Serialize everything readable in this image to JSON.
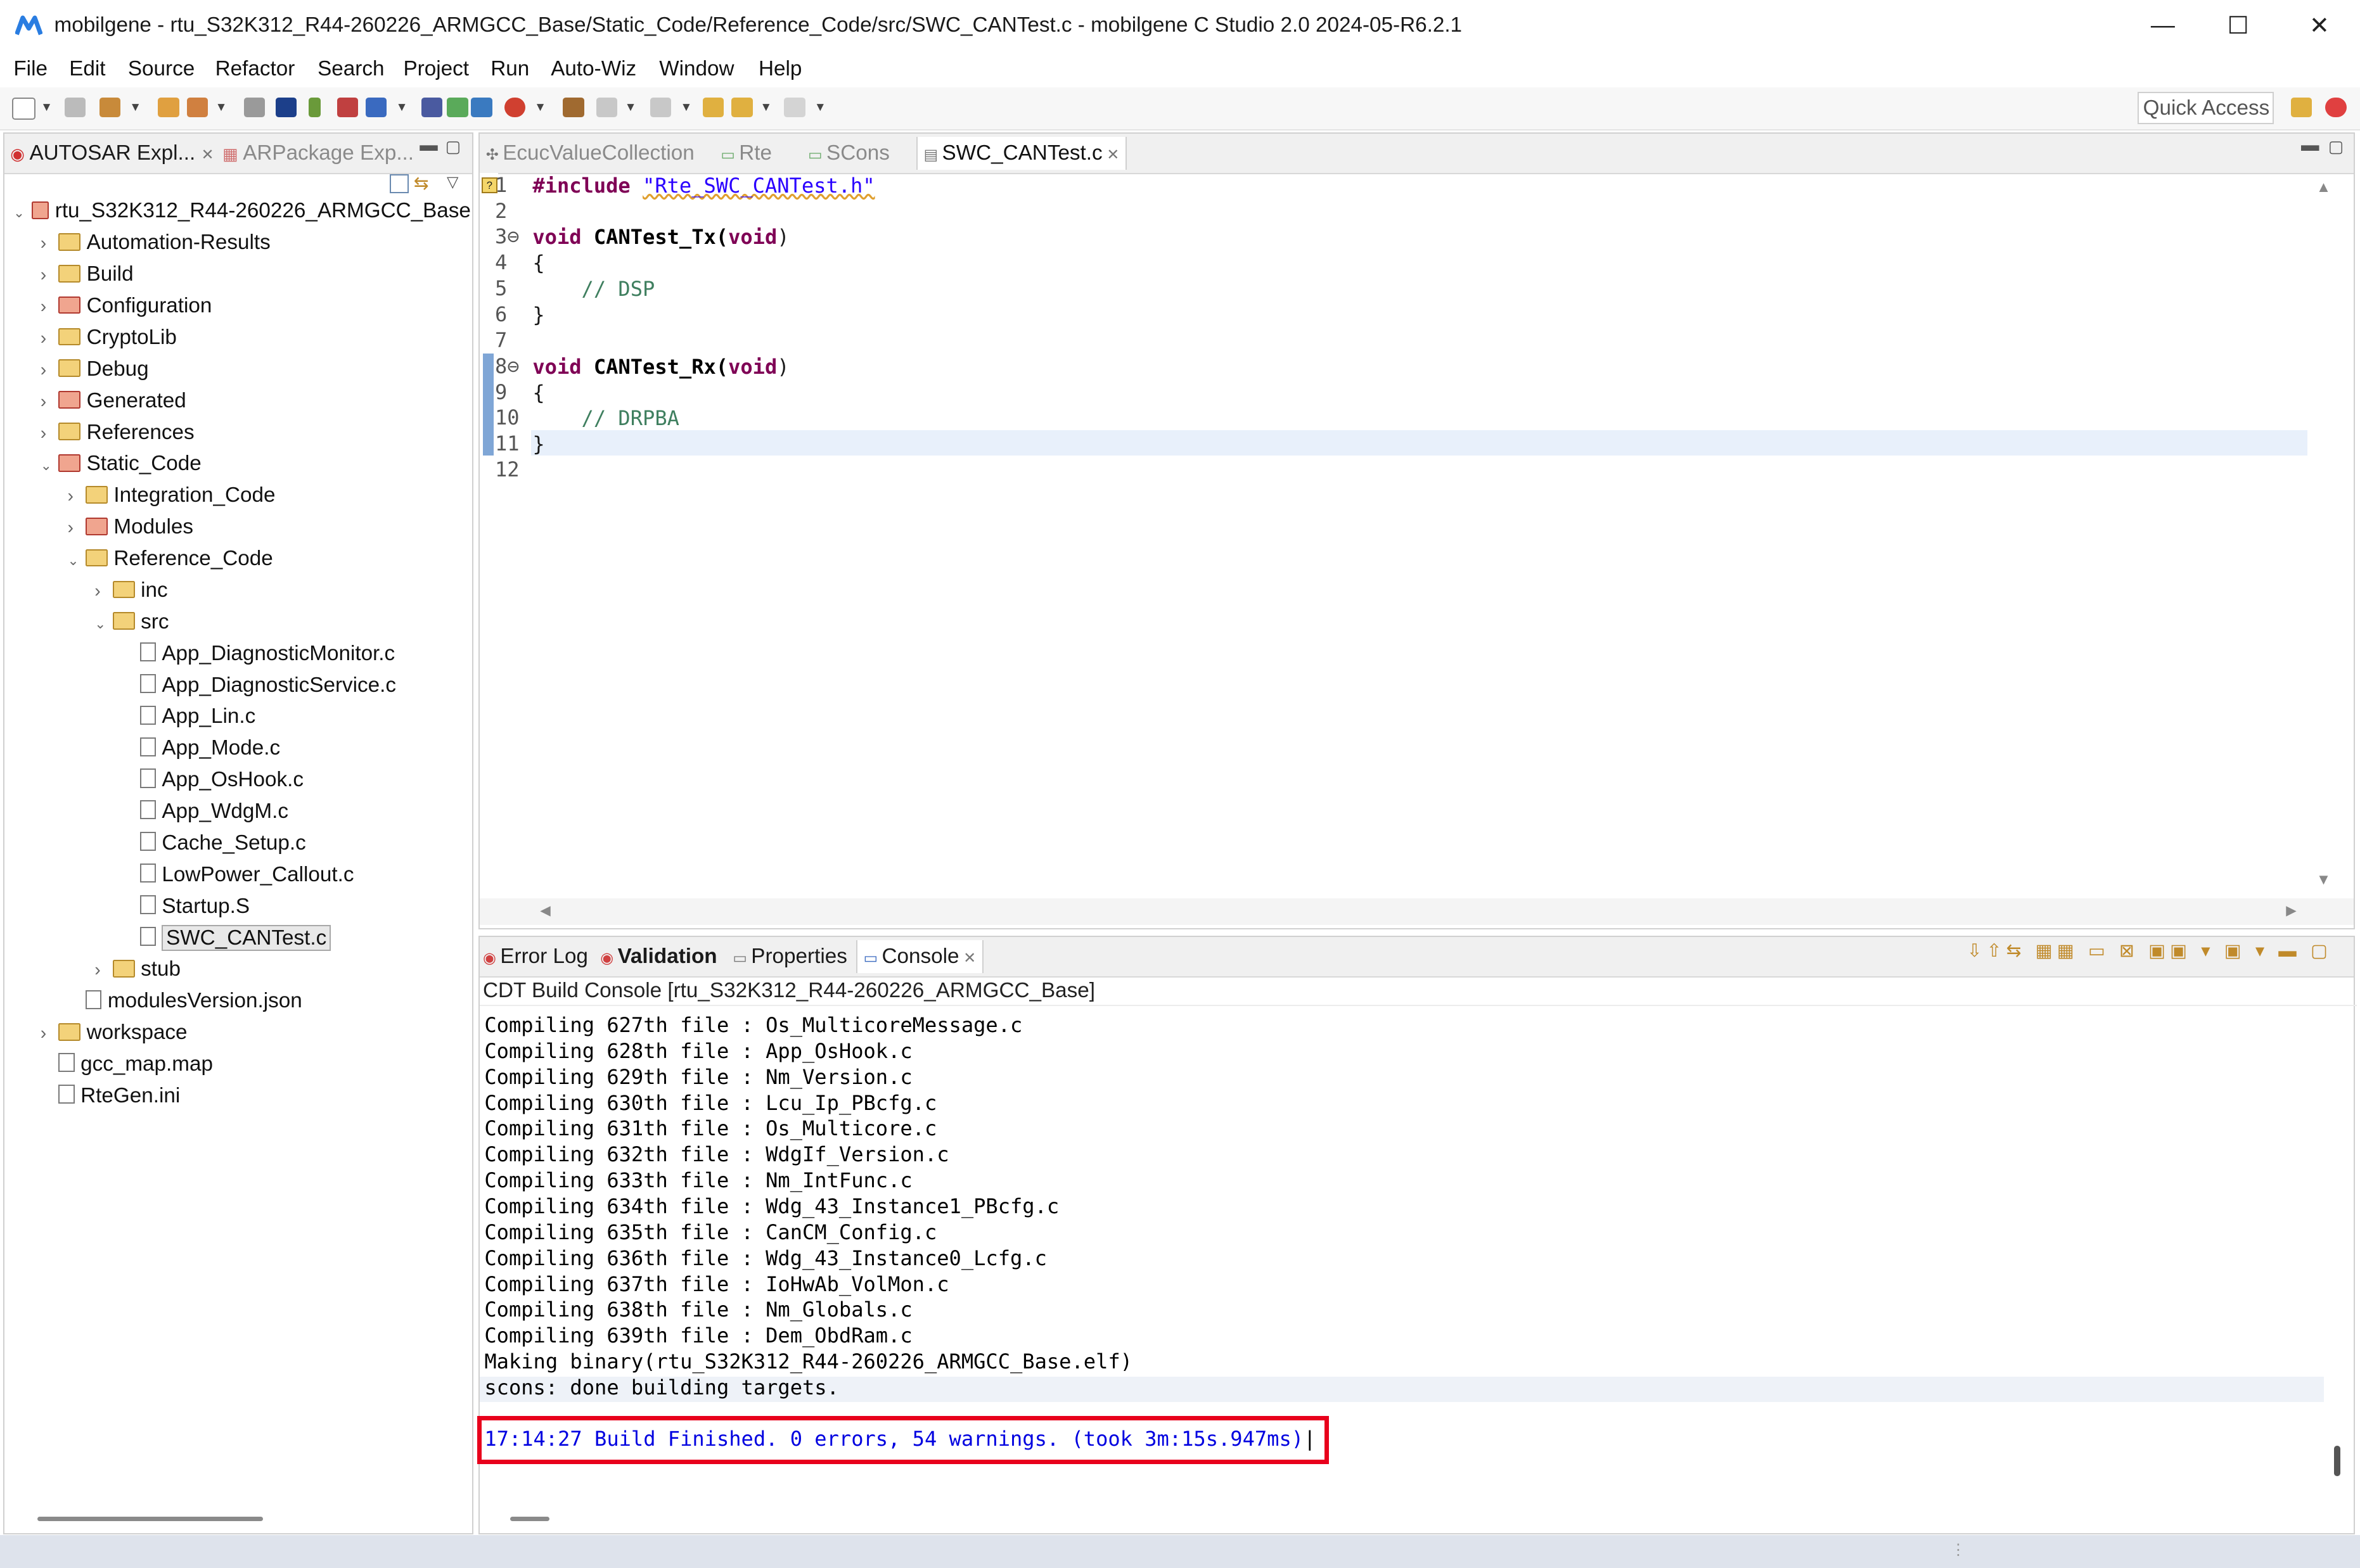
{
  "window": {
    "title": "mobilgene - rtu_S32K312_R44-260226_ARMGCC_Base/Static_Code/Reference_Code/src/SWC_CANTest.c - mobilgene C Studio 2.0 2024-05-R6.2.1",
    "minimize": "—",
    "maximize": "☐",
    "close": "✕"
  },
  "menu": [
    {
      "first": "F",
      "rest": "ile"
    },
    {
      "first": "E",
      "rest": "dit"
    },
    {
      "first": "S",
      "rest": "ource"
    },
    {
      "first": "Refac",
      "rest": "tor",
      "u_after": true
    },
    {
      "first": "Se",
      "rest": "arch",
      "u_after": true
    },
    {
      "first": "P",
      "rest": "roject"
    },
    {
      "first": "R",
      "rest": "un"
    },
    {
      "first": "Auto-Wiz",
      "rest": ""
    },
    {
      "first": "W",
      "rest": "indow"
    },
    {
      "first": "H",
      "rest": "elp"
    }
  ],
  "menu_labels": [
    "File",
    "Edit",
    "Source",
    "Refactor",
    "Search",
    "Project",
    "Run",
    "Auto-Wiz",
    "Window",
    "Help"
  ],
  "toolbar": {
    "quick_access": "Quick Access"
  },
  "left_panel": {
    "tab_autosar": "AUTOSAR Expl...",
    "tab_arpackage": "ARPackage Exp...",
    "tree": [
      {
        "label": "rtu_S32K312_R44-260226_ARMGCC_Base",
        "level": 0,
        "twisty": "open",
        "icon": "project"
      },
      {
        "label": "Automation-Results",
        "level": 1,
        "twisty": "closed",
        "icon": "folder"
      },
      {
        "label": "Build",
        "level": 1,
        "twisty": "closed",
        "icon": "folder"
      },
      {
        "label": "Configuration",
        "level": 1,
        "twisty": "closed",
        "icon": "folder-red"
      },
      {
        "label": "CryptoLib",
        "level": 1,
        "twisty": "closed",
        "icon": "folder"
      },
      {
        "label": "Debug",
        "level": 1,
        "twisty": "closed",
        "icon": "folder"
      },
      {
        "label": "Generated",
        "level": 1,
        "twisty": "closed",
        "icon": "folder-red"
      },
      {
        "label": "References",
        "level": 1,
        "twisty": "closed",
        "icon": "folder"
      },
      {
        "label": "Static_Code",
        "level": 1,
        "twisty": "open",
        "icon": "folder-red"
      },
      {
        "label": "Integration_Code",
        "level": 2,
        "twisty": "closed",
        "icon": "folder"
      },
      {
        "label": "Modules",
        "level": 2,
        "twisty": "closed",
        "icon": "folder-red"
      },
      {
        "label": "Reference_Code",
        "level": 2,
        "twisty": "open",
        "icon": "folder"
      },
      {
        "label": "inc",
        "level": 3,
        "twisty": "closed",
        "icon": "folder"
      },
      {
        "label": "src",
        "level": 3,
        "twisty": "open",
        "icon": "folder"
      },
      {
        "label": "App_DiagnosticMonitor.c",
        "level": 4,
        "twisty": "none",
        "icon": "file"
      },
      {
        "label": "App_DiagnosticService.c",
        "level": 4,
        "twisty": "none",
        "icon": "file"
      },
      {
        "label": "App_Lin.c",
        "level": 4,
        "twisty": "none",
        "icon": "file"
      },
      {
        "label": "App_Mode.c",
        "level": 4,
        "twisty": "none",
        "icon": "file"
      },
      {
        "label": "App_OsHook.c",
        "level": 4,
        "twisty": "none",
        "icon": "file"
      },
      {
        "label": "App_WdgM.c",
        "level": 4,
        "twisty": "none",
        "icon": "file"
      },
      {
        "label": "Cache_Setup.c",
        "level": 4,
        "twisty": "none",
        "icon": "file"
      },
      {
        "label": "LowPower_Callout.c",
        "level": 4,
        "twisty": "none",
        "icon": "file"
      },
      {
        "label": "Startup.S",
        "level": 4,
        "twisty": "none",
        "icon": "file"
      },
      {
        "label": "SWC_CANTest.c",
        "level": 4,
        "twisty": "none",
        "icon": "file",
        "selected": true
      },
      {
        "label": "stub",
        "level": 3,
        "twisty": "closed",
        "icon": "folder"
      },
      {
        "label": "modulesVersion.json",
        "level": 2,
        "twisty": "none",
        "icon": "file"
      },
      {
        "label": "workspace",
        "level": 1,
        "twisty": "closed",
        "icon": "folder"
      },
      {
        "label": "gcc_map.map",
        "level": 1,
        "twisty": "none",
        "icon": "file"
      },
      {
        "label": "RteGen.ini",
        "level": 1,
        "twisty": "none",
        "icon": "file"
      }
    ]
  },
  "editor": {
    "tabs": [
      {
        "label": "EcucValueCollection",
        "active": false
      },
      {
        "label": "Rte",
        "active": false
      },
      {
        "label": "SCons",
        "active": false
      },
      {
        "label": "SWC_CANTest.c",
        "active": true
      }
    ],
    "lines": [
      {
        "n": "1",
        "parts": [
          {
            "t": "#include ",
            "c": "kw"
          },
          {
            "t": "\"Rte_SWC_CANTest.h\"",
            "c": "str"
          }
        ]
      },
      {
        "n": "2",
        "parts": []
      },
      {
        "n": "3⊖",
        "parts": [
          {
            "t": "void",
            "c": "kw"
          },
          {
            "t": " CANTest_Tx(",
            "c": "fn"
          },
          {
            "t": "void",
            "c": "kw"
          },
          {
            "t": ")",
            "c": ""
          }
        ]
      },
      {
        "n": "4",
        "parts": [
          {
            "t": "{",
            "c": ""
          }
        ]
      },
      {
        "n": "5",
        "parts": [
          {
            "t": "    // DSP",
            "c": "cm"
          }
        ]
      },
      {
        "n": "6",
        "parts": [
          {
            "t": "}",
            "c": ""
          }
        ]
      },
      {
        "n": "7",
        "parts": []
      },
      {
        "n": "8⊖",
        "parts": [
          {
            "t": "void",
            "c": "kw"
          },
          {
            "t": " CANTest_Rx(",
            "c": "fn"
          },
          {
            "t": "void",
            "c": "kw"
          },
          {
            "t": ")",
            "c": ""
          }
        ]
      },
      {
        "n": "9",
        "parts": [
          {
            "t": "{",
            "c": ""
          }
        ]
      },
      {
        "n": "10",
        "parts": [
          {
            "t": "    // DRPBA",
            "c": "cm"
          }
        ]
      },
      {
        "n": "11",
        "parts": [
          {
            "t": "}",
            "c": ""
          }
        ]
      },
      {
        "n": "12",
        "parts": []
      }
    ]
  },
  "console": {
    "tabs": [
      {
        "label": "Error Log",
        "bold": false
      },
      {
        "label": "Validation",
        "bold": true
      },
      {
        "label": "Properties",
        "bold": false
      },
      {
        "label": "Console",
        "bold": false
      }
    ],
    "header": "CDT Build Console [rtu_S32K312_R44-260226_ARMGCC_Base]",
    "lines": [
      "Compiling 627th file : Os_MulticoreMessage.c",
      "Compiling 628th file : App_OsHook.c",
      "Compiling 629th file : Nm_Version.c",
      "Compiling 630th file : Lcu_Ip_PBcfg.c",
      "Compiling 631th file : Os_Multicore.c",
      "Compiling 632th file : WdgIf_Version.c",
      "Compiling 633th file : Nm_IntFunc.c",
      "Compiling 634th file : Wdg_43_Instance1_PBcfg.c",
      "Compiling 635th file : CanCM_Config.c",
      "Compiling 636th file : Wdg_43_Instance0_Lcfg.c",
      "Compiling 637th file : IoHwAb_VolMon.c",
      "Compiling 638th file : Nm_Globals.c",
      "Compiling 639th file : Dem_ObdRam.c",
      "Making binary(rtu_S32K312_R44-260226_ARMGCC_Base.elf)",
      "scons: done building targets."
    ],
    "build_finished": "17:14:27 Build Finished. 0 errors, 54 warnings. (took 3m:15s.947ms)"
  }
}
